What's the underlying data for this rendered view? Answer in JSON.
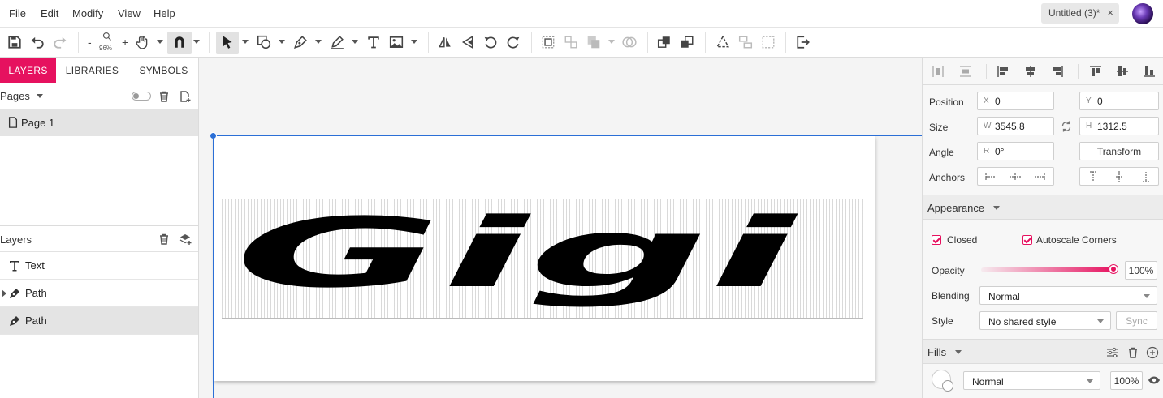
{
  "menu": {
    "file": "File",
    "edit": "Edit",
    "modify": "Modify",
    "view": "View",
    "help": "Help"
  },
  "document_tab": {
    "title": "Untitled (3)*",
    "close": "×"
  },
  "toolbar": {
    "zoom_minus": "-",
    "zoom_plus": "+",
    "zoom_level": "96%"
  },
  "left_panel": {
    "tabs": [
      "LAYERS",
      "LIBRARIES",
      "SYMBOLS"
    ],
    "pages_label": "Pages",
    "pages": [
      "Page 1"
    ],
    "layers_label": "Layers",
    "layers": [
      {
        "name": "Text",
        "kind": "text"
      },
      {
        "name": "Path",
        "kind": "path-group"
      },
      {
        "name": "Path",
        "kind": "path",
        "selected": true
      }
    ]
  },
  "canvas": {
    "artwork_text": "Gigi"
  },
  "inspector": {
    "position_label": "Position",
    "x_prefix": "X",
    "x_value": "0",
    "y_prefix": "Y",
    "y_value": "0",
    "size_label": "Size",
    "w_prefix": "W",
    "w_value": "3545.8",
    "h_prefix": "H",
    "h_value": "1312.5",
    "angle_label": "Angle",
    "r_prefix": "R",
    "r_value": "0°",
    "transform_button": "Transform",
    "anchors_label": "Anchors",
    "appearance_title": "Appearance",
    "closed_label": "Closed",
    "closed_checked": true,
    "autoscale_label": "Autoscale Corners",
    "autoscale_checked": true,
    "opacity_label": "Opacity",
    "opacity_value": "100%",
    "opacity_fraction": 1.0,
    "blending_label": "Blending",
    "blending_value": "Normal",
    "style_label": "Style",
    "style_value": "No shared style",
    "sync_button": "Sync",
    "fills_title": "Fills",
    "fill_blend": "Normal",
    "fill_opacity": "100%"
  },
  "colors": {
    "accent": "#e6115f",
    "selection": "#2b6fd6"
  }
}
